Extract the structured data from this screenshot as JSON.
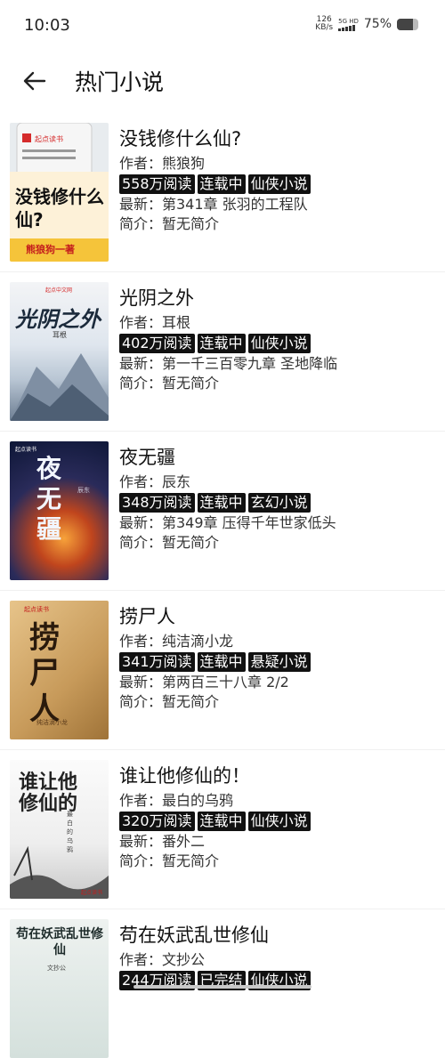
{
  "status": {
    "time": "10:03",
    "net_speed_value": "126",
    "net_speed_unit": "KB/s",
    "signal_label": "5G HD",
    "battery_text": "75%",
    "battery_level": 0.75
  },
  "header": {
    "title": "热门小说"
  },
  "books": [
    {
      "title": "没钱修什么仙?",
      "author": "作者：熊狼狗",
      "reads": "558万阅读",
      "status": "连载中",
      "genre": "仙侠小说",
      "latest": "最新：第341章 张羽的工程队",
      "intro": "简介：暂无简介",
      "cover_text": "没钱修什么仙?",
      "cover_sub": "熊狼狗一著",
      "cover_brand": "起点读书"
    },
    {
      "title": "光阴之外",
      "author": "作者：耳根",
      "reads": "402万阅读",
      "status": "连载中",
      "genre": "仙侠小说",
      "latest": "最新：第一千三百零九章 圣地降临",
      "intro": "简介：暂无简介",
      "cover_text": "光阴之外",
      "cover_sub": "耳根",
      "cover_brand": "起点中文网"
    },
    {
      "title": "夜无疆",
      "author": "作者：辰东",
      "reads": "348万阅读",
      "status": "连载中",
      "genre": "玄幻小说",
      "latest": "最新：第349章 压得千年世家低头",
      "intro": "简介：暂无简介",
      "cover_text": "夜无疆",
      "cover_sub": "辰东",
      "cover_brand": "起点读书"
    },
    {
      "title": "捞尸人",
      "author": "作者：纯洁滴小龙",
      "reads": "341万阅读",
      "status": "连载中",
      "genre": "悬疑小说",
      "latest": "最新：第两百三十八章 2/2",
      "intro": "简介：暂无简介",
      "cover_text": "捞尸人",
      "cover_sub": "纯洁滴小龙",
      "cover_brand": "起点读书"
    },
    {
      "title": "谁让他修仙的！",
      "author": "作者：最白的乌鸦",
      "reads": "320万阅读",
      "status": "连载中",
      "genre": "仙侠小说",
      "latest": "最新：番外二",
      "intro": "简介：暂无简介",
      "cover_text": "谁让他修仙的",
      "cover_sub": "最白的乌鸦",
      "cover_brand": "起点读书"
    },
    {
      "title": "苟在妖武乱世修仙",
      "author": "作者：文抄公",
      "reads": "244万阅读",
      "status": "已完结",
      "genre": "仙侠小说",
      "latest": "",
      "intro": "",
      "cover_text": "苟在妖武乱世修仙",
      "cover_sub": "文抄公",
      "cover_brand": ""
    }
  ]
}
